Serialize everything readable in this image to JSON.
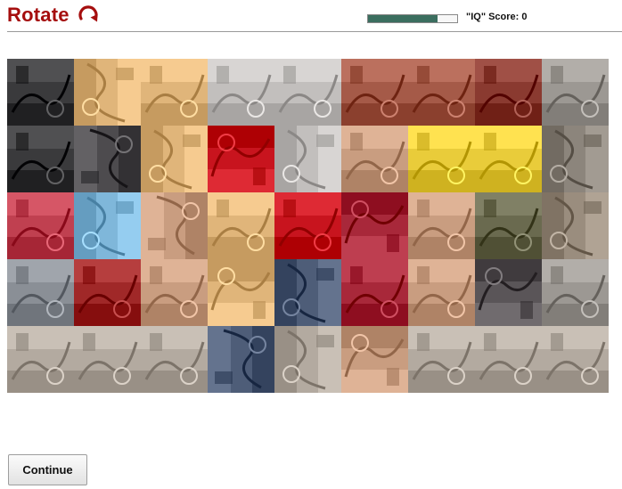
{
  "header": {
    "title": "Rotate",
    "rotate_icon": "rotate-clockwise-icon",
    "title_color": "#a50e0e",
    "progress": {
      "fraction": 0.78,
      "color": "#3b6e5f"
    },
    "score_label": "\"IQ\" Score: 0"
  },
  "puzzle": {
    "columns": 9,
    "rows": 5,
    "palette": {
      "graffiti": "#3a3a3c",
      "shutter": "#5a5558",
      "wall_tan": "#e0b57a",
      "door": "#c2bfbd",
      "brick": "#8a3a30",
      "red_shirt": "#c8141e",
      "skin": "#c99d80",
      "blue_shirt": "#7fb7da",
      "yellow": "#e9cc3a",
      "dress_red": "#a8283a",
      "jeans": "#4e5d78",
      "pavement": "#b3aaa0",
      "bike_frame": "#a02828"
    },
    "tiles": [
      {
        "color": "#3a3a3c",
        "rot": 0
      },
      {
        "color": "#e0b57a",
        "rot": 90
      },
      {
        "color": "#e0b57a",
        "rot": 0
      },
      {
        "color": "#c2bfbd",
        "rot": 0
      },
      {
        "color": "#c2bfbd",
        "rot": 0
      },
      {
        "color": "#a55a48",
        "rot": 0
      },
      {
        "color": "#a55a48",
        "rot": 0
      },
      {
        "color": "#8a3a30",
        "rot": 0
      },
      {
        "color": "#9c9893",
        "rot": 0
      },
      {
        "color": "#3a3a3c",
        "rot": 0
      },
      {
        "color": "#4d4b4e",
        "rot": 270
      },
      {
        "color": "#e0b57a",
        "rot": 90
      },
      {
        "color": "#c8141e",
        "rot": 180
      },
      {
        "color": "#c2bfbd",
        "rot": 90
      },
      {
        "color": "#c99d80",
        "rot": 0
      },
      {
        "color": "#e9cc3a",
        "rot": 0
      },
      {
        "color": "#e9cc3a",
        "rot": 0
      },
      {
        "color": "#8c857c",
        "rot": 90
      },
      {
        "color": "#c04050",
        "rot": 0
      },
      {
        "color": "#7fb7da",
        "rot": 90
      },
      {
        "color": "#c99d80",
        "rot": 270
      },
      {
        "color": "#e0b57a",
        "rot": 0
      },
      {
        "color": "#c8141e",
        "rot": 0
      },
      {
        "color": "#a8283a",
        "rot": 180
      },
      {
        "color": "#c99d80",
        "rot": 0
      },
      {
        "color": "#6a6a4f",
        "rot": 0
      },
      {
        "color": "#9a8d7e",
        "rot": 90
      },
      {
        "color": "#8a8f96",
        "rot": 0
      },
      {
        "color": "#a02828",
        "rot": 0
      },
      {
        "color": "#c99d80",
        "rot": 0
      },
      {
        "color": "#e0b57a",
        "rot": 180
      },
      {
        "color": "#4e5d78",
        "rot": 90
      },
      {
        "color": "#a8283a",
        "rot": 0
      },
      {
        "color": "#c99d80",
        "rot": 0
      },
      {
        "color": "#5a5558",
        "rot": 180
      },
      {
        "color": "#9c9893",
        "rot": 0
      },
      {
        "color": "#b3aaa0",
        "rot": 0
      },
      {
        "color": "#b3aaa0",
        "rot": 0
      },
      {
        "color": "#b3aaa0",
        "rot": 0
      },
      {
        "color": "#4e5d78",
        "rot": 270
      },
      {
        "color": "#b3aaa0",
        "rot": 90
      },
      {
        "color": "#c99d80",
        "rot": 180
      },
      {
        "color": "#b3aaa0",
        "rot": 0
      },
      {
        "color": "#b3aaa0",
        "rot": 0
      },
      {
        "color": "#b3aaa0",
        "rot": 0
      }
    ]
  },
  "actions": {
    "continue_label": "Continue"
  }
}
